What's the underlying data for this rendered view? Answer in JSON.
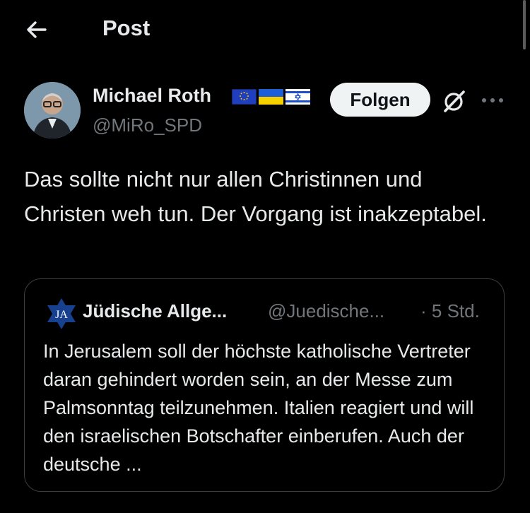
{
  "header": {
    "title": "Post",
    "back_icon": "arrow-left-icon"
  },
  "author": {
    "name": "Michael Roth",
    "handle": "@MiRo_SPD",
    "flags": [
      "eu-flag-icon",
      "ukraine-flag-icon",
      "israel-flag-icon"
    ]
  },
  "actions": {
    "follow_label": "Folgen",
    "grok_icon": "grok-icon",
    "more_icon": "more-icon"
  },
  "post": {
    "text": "Das sollte nicht nur allen Christinnen und Christen weh tun. Der Vorgang ist inakzeptabel."
  },
  "quote": {
    "logo_text": "JA",
    "name": "Jüdische Allge...",
    "handle": "@Juedische...",
    "time": "· 5 Std.",
    "text": "In Jerusalem soll der höchste katholische Vertreter daran gehindert worden sein, an der Messe zum Palmsonntag teilzunehmen. Italien reagiert und will den israelischen Botschafter einberufen. Auch der deutsche ..."
  },
  "colors": {
    "background": "#000000",
    "text": "#e7e9ea",
    "muted": "#71767b",
    "border": "#3a3d41",
    "button_bg": "#eff3f4"
  }
}
